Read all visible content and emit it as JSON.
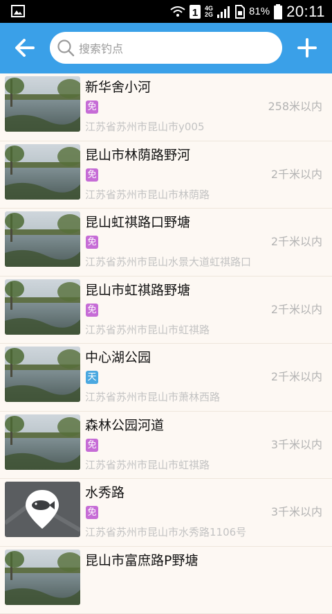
{
  "status_bar": {
    "network": [
      "4G",
      "2G"
    ],
    "battery_percent": "81%",
    "time": "20:11"
  },
  "header": {
    "search_placeholder": "搜索钓点"
  },
  "spots": [
    {
      "name": "新华舍小河",
      "badge": "免",
      "badge_type": "free",
      "distance": "258米以内",
      "address": "江苏省苏州市昆山市y005",
      "thumb": "water"
    },
    {
      "name": "昆山市林荫路野河",
      "badge": "免",
      "badge_type": "free",
      "distance": "2千米以内",
      "address": "江苏省苏州市昆山市林荫路",
      "thumb": "water"
    },
    {
      "name": "昆山虹祺路口野塘",
      "badge": "免",
      "badge_type": "free",
      "distance": "2千米以内",
      "address": "江苏省苏州市昆山水景大道虹祺路口",
      "thumb": "water"
    },
    {
      "name": "昆山市虹祺路野塘",
      "badge": "免",
      "badge_type": "free",
      "distance": "2千米以内",
      "address": "江苏省苏州市昆山市虹祺路",
      "thumb": "water"
    },
    {
      "name": "中心湖公园",
      "badge": "天",
      "badge_type": "day",
      "distance": "2千米以内",
      "address": "江苏省苏州市昆山市萧林西路",
      "thumb": "water"
    },
    {
      "name": "森林公园河道",
      "badge": "免",
      "badge_type": "free",
      "distance": "3千米以内",
      "address": "江苏省苏州市昆山市虹祺路",
      "thumb": "water"
    },
    {
      "name": "水秀路",
      "badge": "免",
      "badge_type": "free",
      "distance": "3千米以内",
      "address": "江苏省苏州市昆山市水秀路1106号",
      "thumb": "fish-placeholder"
    },
    {
      "name": "昆山市富庶路P野塘",
      "badge": "",
      "badge_type": "free",
      "distance": "",
      "address": "",
      "thumb": "water"
    }
  ],
  "colors": {
    "app_bar": "#3aa0e8",
    "badge_free": "#c66cd6",
    "badge_day": "#4aa8e0",
    "background": "#fdf8f3"
  },
  "icons": {
    "back": "back-arrow-icon",
    "search": "search-icon",
    "add": "plus-icon",
    "placeholder": "fish-pin-icon"
  }
}
